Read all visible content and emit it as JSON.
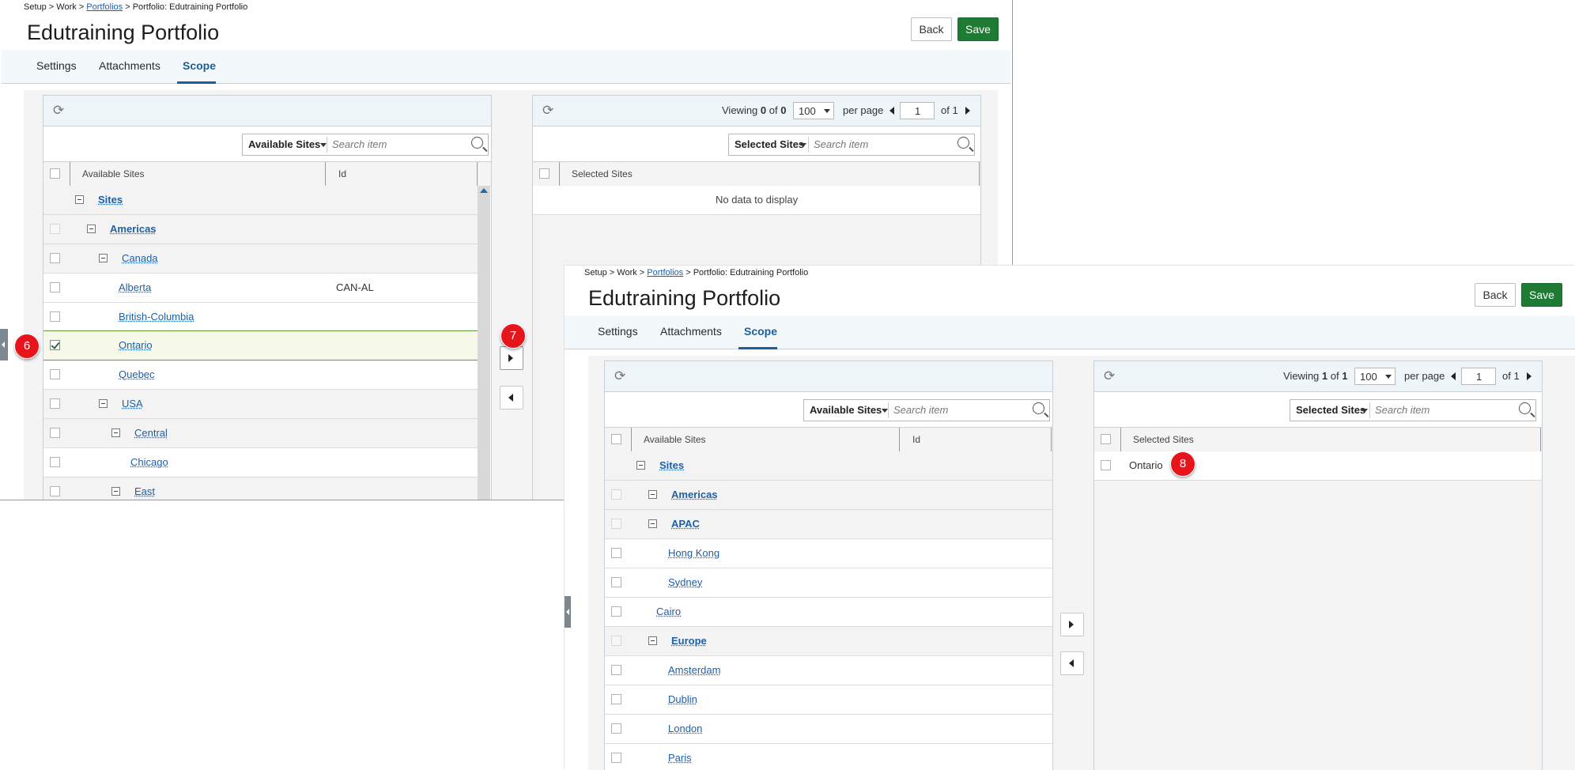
{
  "screen1": {
    "breadcrumb": {
      "part1": "Setup > Work > ",
      "link": "Portfolios",
      "part2": " > Portfolio: Edutraining Portfolio"
    },
    "title": "Edutraining Portfolio",
    "back_label": "Back",
    "save_label": "Save",
    "tabs": [
      "Settings",
      "Attachments",
      "Scope"
    ],
    "active_tab": "Scope",
    "available": {
      "search_dropdown": "Available Sites",
      "search_placeholder": "Search item",
      "col_name": "Available Sites",
      "col_id": "Id",
      "rows": [
        {
          "label": "Sites",
          "id": ""
        },
        {
          "label": "Americas",
          "id": ""
        },
        {
          "label": "Canada",
          "id": ""
        },
        {
          "label": "Alberta",
          "id": "CAN-AL"
        },
        {
          "label": "British-Columbia",
          "id": ""
        },
        {
          "label": "Ontario",
          "id": "",
          "checked": true
        },
        {
          "label": "Quebec",
          "id": ""
        },
        {
          "label": "USA",
          "id": ""
        },
        {
          "label": "Central",
          "id": ""
        },
        {
          "label": "Chicago",
          "id": ""
        },
        {
          "label": "East",
          "id": ""
        }
      ]
    },
    "selected": {
      "pager": {
        "viewing": "Viewing",
        "count": "0",
        "of_word": "of",
        "total": "0",
        "per_page_value": "100",
        "per_page_label": "per page",
        "page": "1",
        "of_pages": "of 1"
      },
      "search_dropdown": "Selected Sites",
      "search_placeholder": "Search item",
      "col_name": "Selected Sites",
      "empty_text": "No data to display"
    },
    "badges": {
      "b6": "6",
      "b7": "7"
    }
  },
  "screen2": {
    "breadcrumb": {
      "part1": "Setup > Work > ",
      "link": "Portfolios",
      "part2": " > Portfolio: Edutraining Portfolio"
    },
    "title": "Edutraining Portfolio",
    "back_label": "Back",
    "save_label": "Save",
    "tabs": [
      "Settings",
      "Attachments",
      "Scope"
    ],
    "active_tab": "Scope",
    "available": {
      "search_dropdown": "Available Sites",
      "search_placeholder": "Search item",
      "col_name": "Available Sites",
      "col_id": "Id",
      "rows": [
        {
          "label": "Sites"
        },
        {
          "label": "Americas"
        },
        {
          "label": "APAC"
        },
        {
          "label": "Hong Kong"
        },
        {
          "label": "Sydney"
        },
        {
          "label": "Cairo"
        },
        {
          "label": "Europe"
        },
        {
          "label": "Amsterdam"
        },
        {
          "label": "Dublin"
        },
        {
          "label": "London"
        },
        {
          "label": "Paris"
        }
      ]
    },
    "selected": {
      "pager": {
        "viewing": "Viewing",
        "count": "1",
        "of_word": "of",
        "total": "1",
        "per_page_value": "100",
        "per_page_label": "per page",
        "page": "1",
        "of_pages": "of 1"
      },
      "search_dropdown": "Selected Sites",
      "search_placeholder": "Search item",
      "col_name": "Selected Sites",
      "rows": [
        {
          "label": "Ontario"
        }
      ]
    },
    "badges": {
      "b8": "8"
    }
  }
}
